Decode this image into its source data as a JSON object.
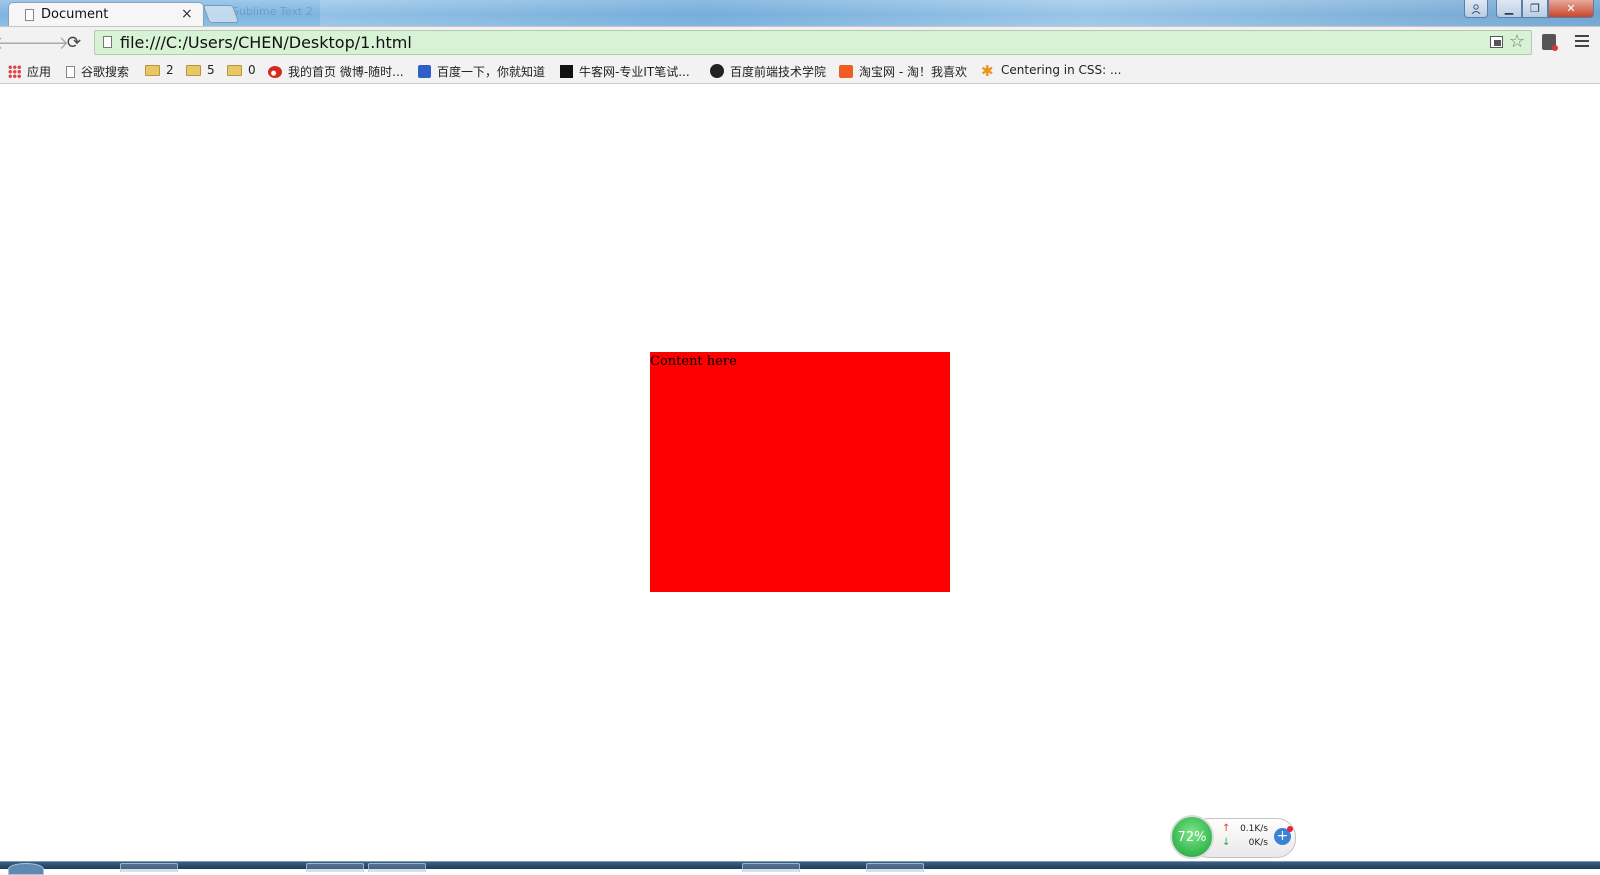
{
  "browser": {
    "tab": {
      "title": "Document",
      "close_label": "×"
    },
    "ghost_tab_title": "Sublime Text 2",
    "window_controls": {
      "minimize": "▁",
      "maximize": "❐",
      "close": "✕"
    },
    "url": "file:///C:/Users/CHEN/Desktop/1.html",
    "icons": {
      "back": "back-arrow-icon",
      "forward": "forward-arrow-icon",
      "reload": "reload-icon",
      "star": "star-icon",
      "menu": "menu-icon"
    },
    "nav_glyphs": {
      "back": "🡐",
      "forward": "🡒",
      "reload": "⟳",
      "star": "☆"
    }
  },
  "bookmarks": [
    {
      "label": "应用",
      "icon": "apps-icon"
    },
    {
      "label": "谷歌搜索",
      "icon": "page-icon"
    },
    {
      "label": "2",
      "icon": "folder-icon"
    },
    {
      "label": "5",
      "icon": "folder-icon"
    },
    {
      "label": "0",
      "icon": "folder-icon"
    },
    {
      "label": "我的首页 微博-随时...",
      "icon": "weibo-icon"
    },
    {
      "label": "百度一下，你就知道",
      "icon": "baidu-icon"
    },
    {
      "label": "牛客网-专业IT笔试...",
      "icon": "nowcoder-icon"
    },
    {
      "label": "百度前端技术学院",
      "icon": "ife-icon"
    },
    {
      "label": "淘宝网 - 淘！我喜欢",
      "icon": "taobao-icon"
    },
    {
      "label": "Centering in CSS: ...",
      "icon": "asterisk-icon"
    }
  ],
  "page": {
    "content_text": "Content here",
    "box_color": "#ff0000"
  },
  "network_widget": {
    "percent": "72%",
    "upload_rate": "0.1K/s",
    "download_rate": "0K/s",
    "up_arrow": "↑",
    "down_arrow": "↓",
    "plus": "+"
  }
}
